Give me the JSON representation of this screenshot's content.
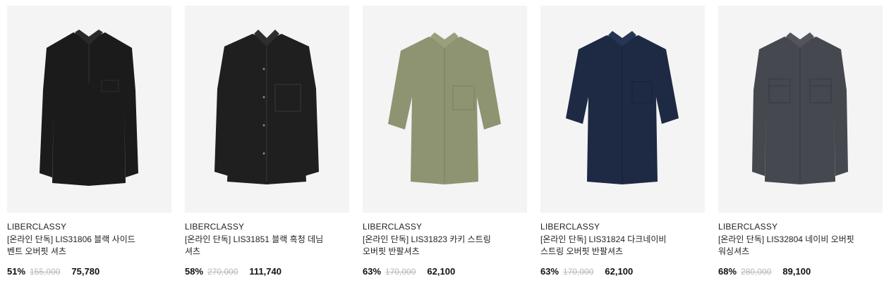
{
  "products": [
    {
      "brand": "LIBERCLASSY",
      "title": "[온라인 단독] LIS31806 블랙 사이드 벤트 오버핏 셔츠",
      "discount": "51%",
      "original_price": "155,000",
      "sale_price": "75,780",
      "image_icon": "black-shirt-image",
      "color": "#1b1b1b"
    },
    {
      "brand": "LIBERCLASSY",
      "title": "[온라인 단독] LIS31851 블랙 흑청 데님 셔츠",
      "discount": "58%",
      "original_price": "270,000",
      "sale_price": "111,740",
      "image_icon": "black-denim-shirt-image",
      "color": "#1f1f1f"
    },
    {
      "brand": "LIBERCLASSY",
      "title": "[온라인 단독] LIS31823 카키 스트링 오버핏 반팔셔츠",
      "discount": "63%",
      "original_price": "170,000",
      "sale_price": "62,100",
      "image_icon": "khaki-short-sleeve-shirt-image",
      "color": "#8e9471"
    },
    {
      "brand": "LIBERCLASSY",
      "title": "[온라인 단독] LIS31824 다크네이비 스트링 오버핏 반팔셔츠",
      "discount": "63%",
      "original_price": "170,000",
      "sale_price": "62,100",
      "image_icon": "navy-short-sleeve-shirt-image",
      "color": "#1e2a44"
    },
    {
      "brand": "LIBERCLASSY",
      "title": "[온라인 단독] LIS32804 네이비 오버핏 워싱셔츠",
      "discount": "68%",
      "original_price": "280,000",
      "sale_price": "89,100",
      "image_icon": "washed-shirt-image",
      "color": "#45484f"
    }
  ]
}
